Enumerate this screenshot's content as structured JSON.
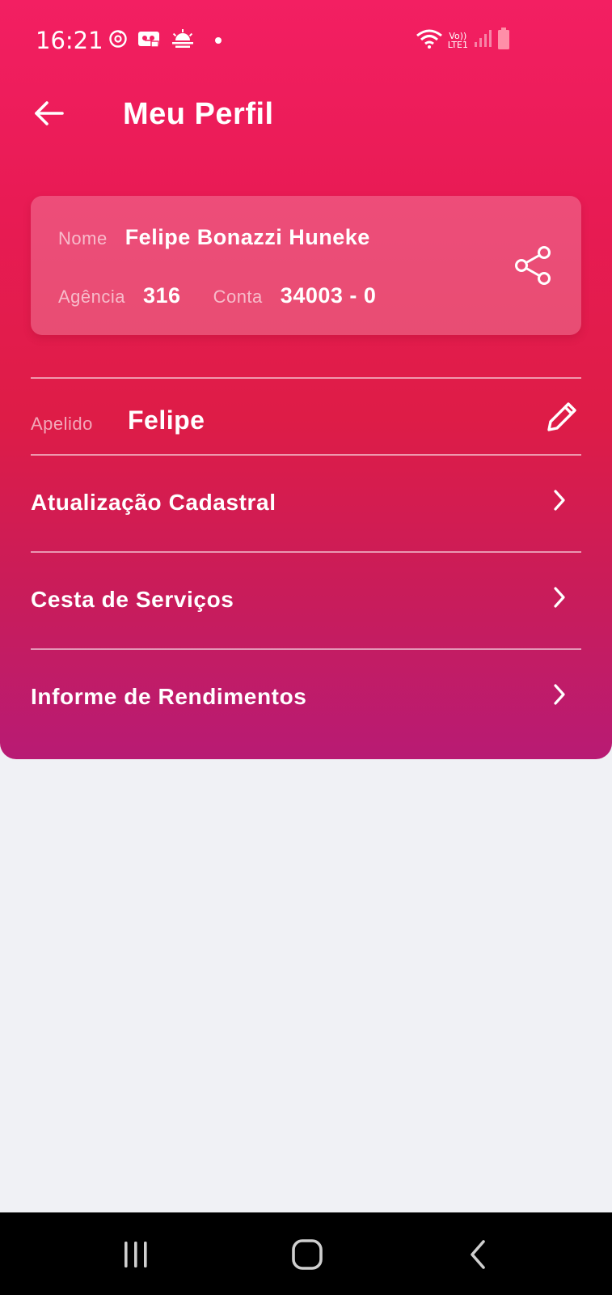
{
  "status_bar": {
    "time": "16:21",
    "network_label_top": "Vo))",
    "network_label_bottom": "LTE1",
    "icons": [
      "sync-icon",
      "voicemail-icon",
      "weather-icon",
      "notification-dot",
      "wifi-icon",
      "signal-icon",
      "battery-icon"
    ]
  },
  "header": {
    "title": "Meu Perfil",
    "back_icon": "arrow-left-icon"
  },
  "profile_card": {
    "name_label": "Nome",
    "name_value": "Felipe Bonazzi Huneke",
    "branch_label": "Agência",
    "branch_value": "316",
    "account_label": "Conta",
    "account_value": "34003 - 0",
    "share_icon": "share-icon"
  },
  "nickname": {
    "label": "Apelido",
    "value": "Felipe",
    "edit_icon": "pencil-icon"
  },
  "menu": {
    "items": [
      {
        "label": "Atualização Cadastral"
      },
      {
        "label": "Cesta de Serviços"
      },
      {
        "label": "Informe de Rendimentos"
      }
    ]
  },
  "colors": {
    "gradient_top": "#f31f62",
    "gradient_bottom": "#b81b74",
    "background": "#f0f1f5",
    "nav_bar": "#000000"
  }
}
